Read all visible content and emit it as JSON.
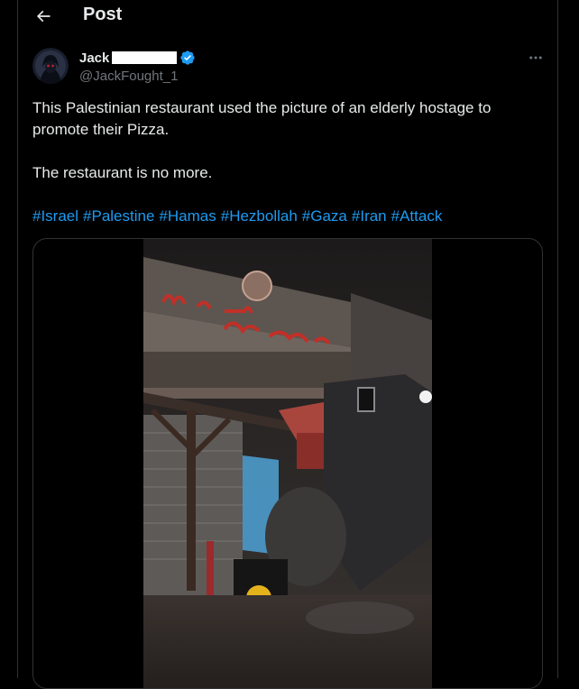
{
  "header": {
    "title": "Post",
    "back_icon": "arrow-left-icon"
  },
  "author": {
    "name": "Jack",
    "handle": "@JackFought_1",
    "verified_icon": "verified-badge-icon",
    "verified_color": "#1d9bf0"
  },
  "tweet": {
    "text1": "This Palestinian restaurant used the picture of an elderly hostage to promote their Pizza.",
    "text2": "The restaurant is no more.",
    "hashtags": [
      "#Israel",
      "#Palestine",
      "#Hamas",
      "#Hezbollah",
      "#Gaza",
      "#Iran",
      "#Attack"
    ]
  },
  "media": {
    "type": "video"
  },
  "colors": {
    "link": "#1d9bf0",
    "text": "#e7e9ea",
    "muted": "#71767b",
    "border": "#2f3336"
  }
}
